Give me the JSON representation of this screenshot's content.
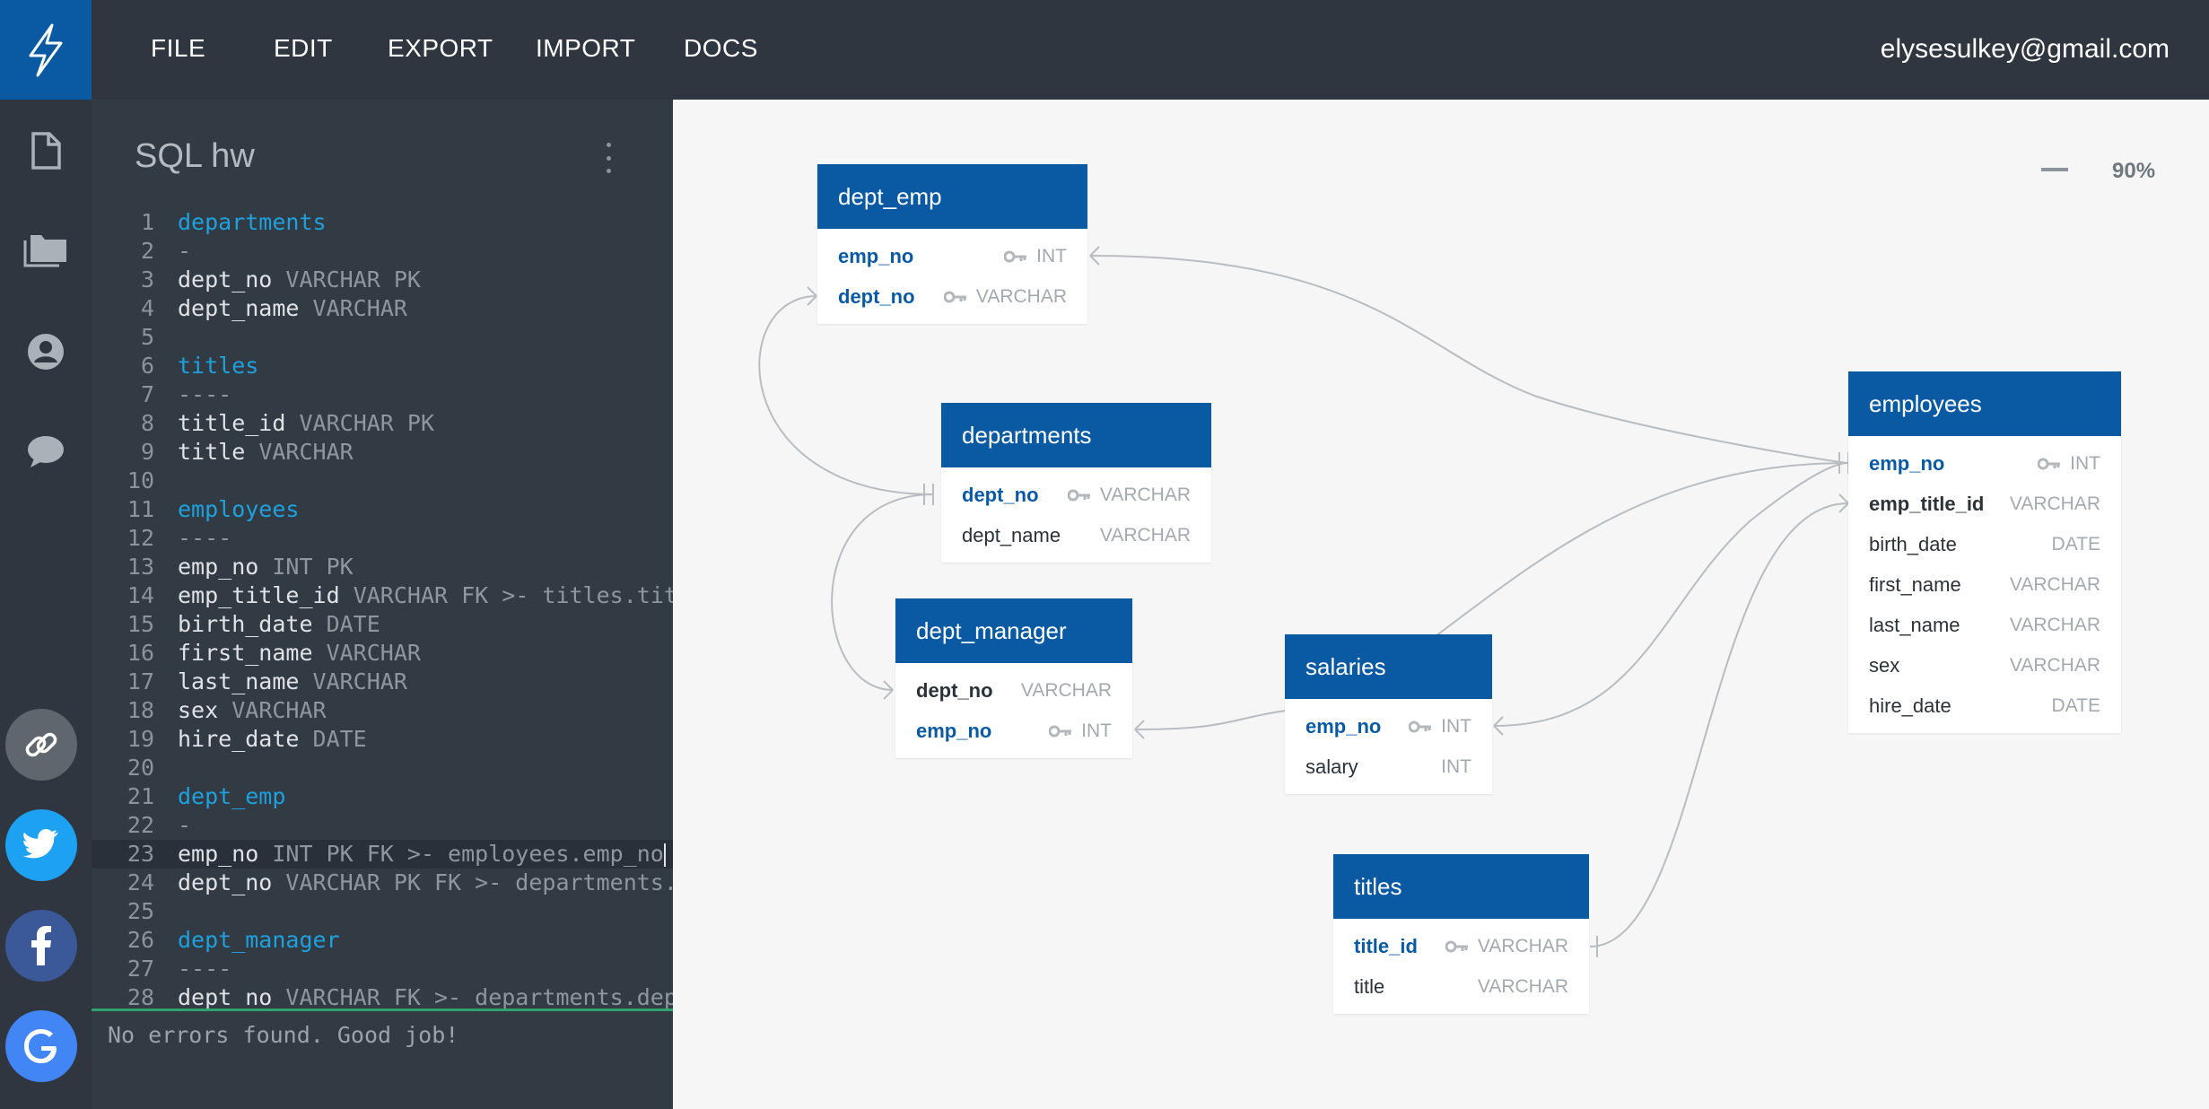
{
  "menu": {
    "file": "FILE",
    "edit": "EDIT",
    "export": "EXPORT",
    "import": "IMPORT",
    "docs": "DOCS"
  },
  "user": {
    "email": "elysesulkey@gmail.com"
  },
  "editor": {
    "title": "SQL hw",
    "lines": [
      {
        "n": "1",
        "name": "departments",
        "kind": "title"
      },
      {
        "n": "2",
        "text": "-",
        "kind": "dash"
      },
      {
        "n": "3",
        "name": "dept_no",
        "type": "VARCHAR PK",
        "kind": "field"
      },
      {
        "n": "4",
        "name": "dept_name",
        "type": "VARCHAR",
        "kind": "field"
      },
      {
        "n": "5",
        "kind": "blank"
      },
      {
        "n": "6",
        "name": "titles",
        "kind": "title"
      },
      {
        "n": "7",
        "text": "----",
        "kind": "dash"
      },
      {
        "n": "8",
        "name": "title_id",
        "type": "VARCHAR PK",
        "kind": "field"
      },
      {
        "n": "9",
        "name": "title",
        "type": "VARCHAR",
        "kind": "field"
      },
      {
        "n": "10",
        "kind": "blank"
      },
      {
        "n": "11",
        "name": "employees",
        "kind": "title"
      },
      {
        "n": "12",
        "text": "----",
        "kind": "dash"
      },
      {
        "n": "13",
        "name": "emp_no",
        "type": "INT PK",
        "kind": "field"
      },
      {
        "n": "14",
        "name": "emp_title_id",
        "type": "VARCHAR FK >- titles.title_id",
        "kind": "field"
      },
      {
        "n": "15",
        "name": "birth_date",
        "type": "DATE",
        "kind": "field"
      },
      {
        "n": "16",
        "name": "first_name",
        "type": "VARCHAR",
        "kind": "field"
      },
      {
        "n": "17",
        "name": "last_name",
        "type": "VARCHAR",
        "kind": "field"
      },
      {
        "n": "18",
        "name": "sex",
        "type": "VARCHAR",
        "kind": "field"
      },
      {
        "n": "19",
        "name": "hire_date",
        "type": "DATE",
        "kind": "field"
      },
      {
        "n": "20",
        "kind": "blank"
      },
      {
        "n": "21",
        "name": "dept_emp",
        "kind": "title"
      },
      {
        "n": "22",
        "text": "-",
        "kind": "dash"
      },
      {
        "n": "23",
        "name": "emp_no",
        "type": "INT PK FK >- employees.emp_no",
        "kind": "field",
        "active": true
      },
      {
        "n": "24",
        "name": "dept_no",
        "type": "VARCHAR PK FK >- departments.dept_no",
        "kind": "field"
      },
      {
        "n": "25",
        "kind": "blank"
      },
      {
        "n": "26",
        "name": "dept_manager",
        "kind": "title"
      },
      {
        "n": "27",
        "text": "----",
        "kind": "dash"
      },
      {
        "n": "28",
        "name": "dept_no",
        "type": "VARCHAR FK >- departments.dept_no",
        "kind": "field"
      }
    ],
    "status": "No errors found. Good job!"
  },
  "canvas": {
    "zoom": "90%",
    "tables": {
      "dept_emp": {
        "title": "dept_emp",
        "rows": [
          {
            "name": "emp_no",
            "type": "INT",
            "key": true,
            "style": "pk"
          },
          {
            "name": "dept_no",
            "type": "VARCHAR",
            "key": true,
            "style": "pk"
          }
        ]
      },
      "departments": {
        "title": "departments",
        "rows": [
          {
            "name": "dept_no",
            "type": "VARCHAR",
            "key": true,
            "style": "pk"
          },
          {
            "name": "dept_name",
            "type": "VARCHAR",
            "key": false,
            "style": "plain"
          }
        ]
      },
      "dept_manager": {
        "title": "dept_manager",
        "rows": [
          {
            "name": "dept_no",
            "type": "VARCHAR",
            "key": false,
            "style": "fk"
          },
          {
            "name": "emp_no",
            "type": "INT",
            "key": true,
            "style": "pk"
          }
        ]
      },
      "salaries": {
        "title": "salaries",
        "rows": [
          {
            "name": "emp_no",
            "type": "INT",
            "key": true,
            "style": "pk"
          },
          {
            "name": "salary",
            "type": "INT",
            "key": false,
            "style": "plain"
          }
        ]
      },
      "titles": {
        "title": "titles",
        "rows": [
          {
            "name": "title_id",
            "type": "VARCHAR",
            "key": true,
            "style": "pk"
          },
          {
            "name": "title",
            "type": "VARCHAR",
            "key": false,
            "style": "plain"
          }
        ]
      },
      "employees": {
        "title": "employees",
        "rows": [
          {
            "name": "emp_no",
            "type": "INT",
            "key": true,
            "style": "pk"
          },
          {
            "name": "emp_title_id",
            "type": "VARCHAR",
            "key": false,
            "style": "fk"
          },
          {
            "name": "birth_date",
            "type": "DATE",
            "key": false,
            "style": "plain"
          },
          {
            "name": "first_name",
            "type": "VARCHAR",
            "key": false,
            "style": "plain"
          },
          {
            "name": "last_name",
            "type": "VARCHAR",
            "key": false,
            "style": "plain"
          },
          {
            "name": "sex",
            "type": "VARCHAR",
            "key": false,
            "style": "plain"
          },
          {
            "name": "hire_date",
            "type": "DATE",
            "key": false,
            "style": "plain"
          }
        ]
      }
    }
  },
  "colors": {
    "header": "#0a5aa3",
    "sidebar": "#2f3640",
    "editor": "#323a43",
    "keyword": "#1ea1dd",
    "twitter": "#1da1f2",
    "facebook": "#3b5998",
    "google": "#4285f4"
  },
  "icons": [
    "lightning-logo-icon",
    "document-icon",
    "folder-icon",
    "user-icon",
    "chat-icon",
    "link-icon",
    "twitter-icon",
    "facebook-icon",
    "google-icon",
    "key-icon",
    "more-vertical-icon",
    "zoom-minus-icon"
  ]
}
